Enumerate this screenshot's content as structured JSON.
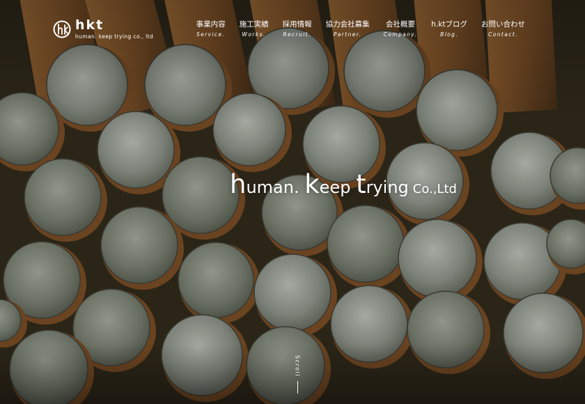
{
  "brand": {
    "name": "hkt",
    "subtitle": "human. keep trying co., ltd"
  },
  "nav": [
    {
      "jp": "事業内容",
      "en": "Service."
    },
    {
      "jp": "施工実績",
      "en": "Works."
    },
    {
      "jp": "採用情報",
      "en": "Recruit."
    },
    {
      "jp": "協力会社募集",
      "en": "Partner."
    },
    {
      "jp": "会社概要",
      "en": "Company."
    },
    {
      "jp": "h.ktブログ",
      "en": "Blog."
    },
    {
      "jp": "お問い合わせ",
      "en": "Contact."
    }
  ],
  "hero": {
    "t1": "h",
    "t2": "uman. ",
    "t3": "k",
    "t4": "eep ",
    "t5": "t",
    "t6": "rying",
    "t7": "Co.,Ltd"
  },
  "scroll": "Scroll",
  "colors": {
    "steel": "#6b7265",
    "rust": "#8a5a2b",
    "text": "#ffffff"
  },
  "icons": {
    "logo": "hkt-logo-mark"
  }
}
